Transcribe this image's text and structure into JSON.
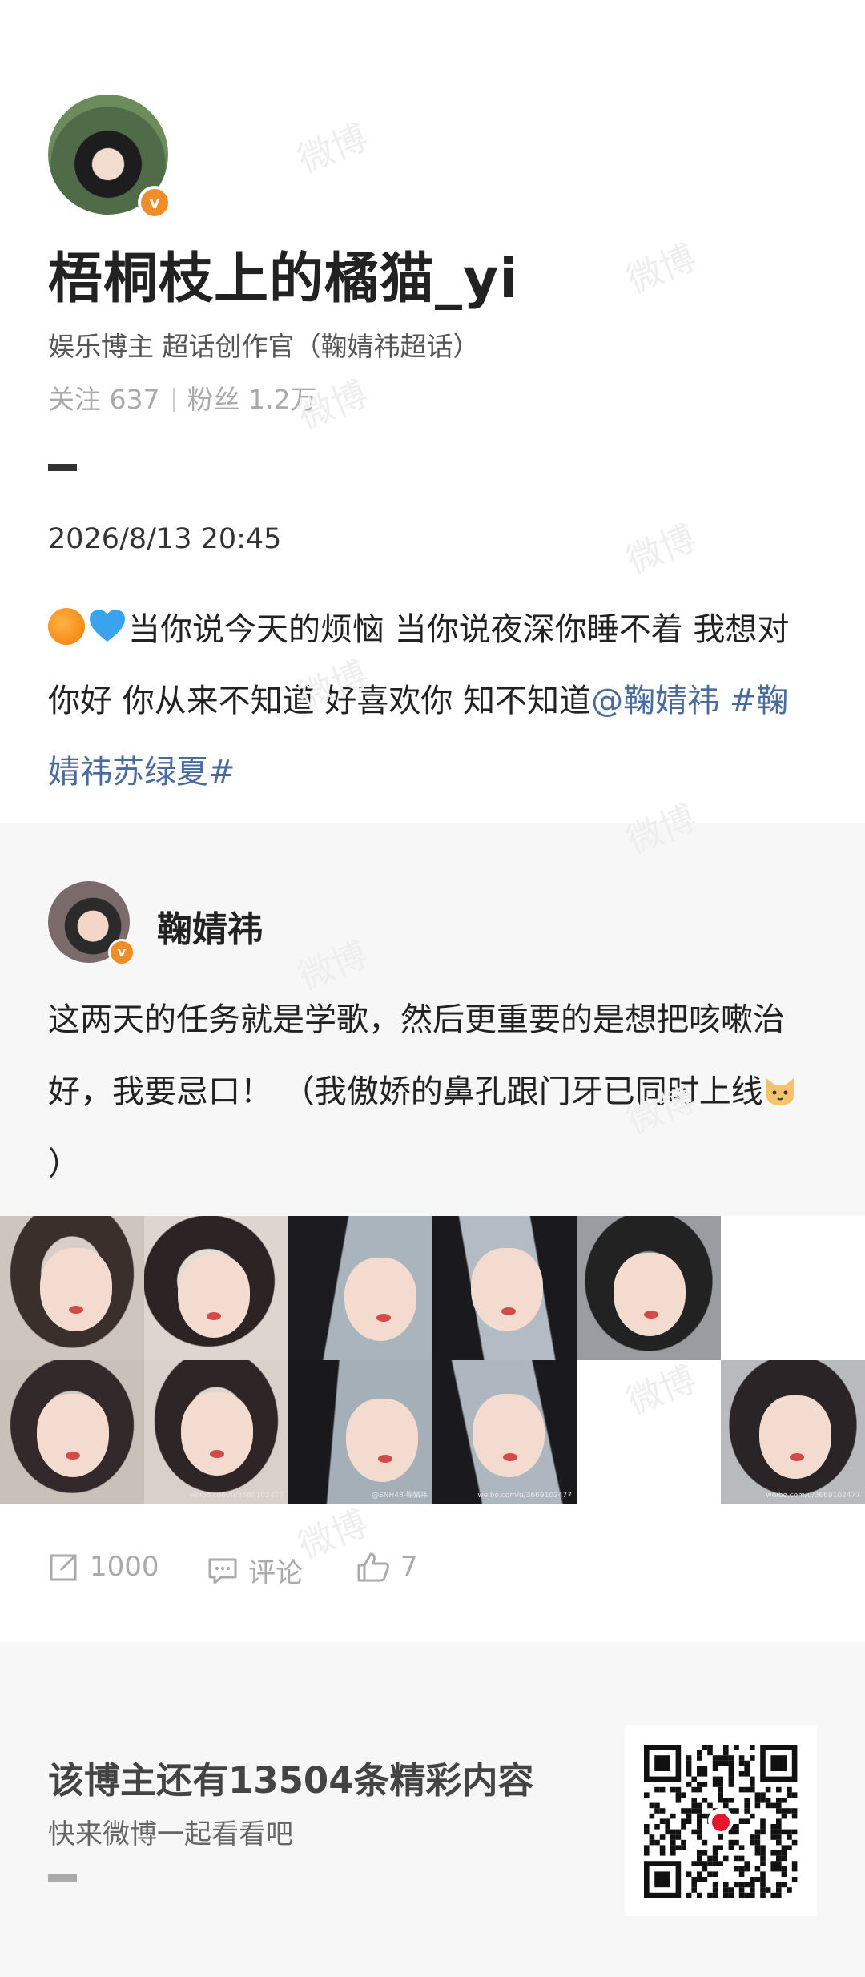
{
  "watermark": "微博",
  "profile": {
    "username": "梧桐枝上的橘猫_yi",
    "verified_mark": "v",
    "description": "娱乐博主 超话创作官（鞠婧祎超话）",
    "following_label": "关注",
    "following_count": "637",
    "followers_label": "粉丝",
    "followers_count": "1.2万"
  },
  "post": {
    "date": "2026/8/13 20:45",
    "emojis": [
      "orange-emoji",
      "blue-heart-emoji"
    ],
    "text": "当你说今天的烦恼 当你说夜深你睡不着 我想对你好 你从来不知道 好喜欢你 知不知道",
    "mention": "@鞠婧祎",
    "hashtag": " #鞠婧祎苏绿夏#"
  },
  "original_post": {
    "author": "鞠婧祎",
    "verified_mark": "v",
    "text": "这两天的任务就是学歌，然后更重要的是想把咳嗽治好，我要忌口！ （我傲娇的鼻孔跟门牙已同时上线",
    "emoji": "cat-emoji",
    "text_end": "）",
    "photo_captions": [
      "@SNH48-鞠婧祎",
      "weibo.com/u/3669102477",
      "@SNH48-鞠婧祎",
      "weibo.com/u/3669102477",
      "weibo.com/u/3669102477"
    ]
  },
  "actions": {
    "repost_count": "1000",
    "comment_label": "评论",
    "like_count": "7"
  },
  "footer": {
    "title": "该博主还有13504条精彩内容",
    "subtitle": "快来微博一起看看吧"
  },
  "colors": {
    "link": "#4a6b9b",
    "verified_badge": "#f08d29",
    "muted": "#aaaaaa"
  }
}
